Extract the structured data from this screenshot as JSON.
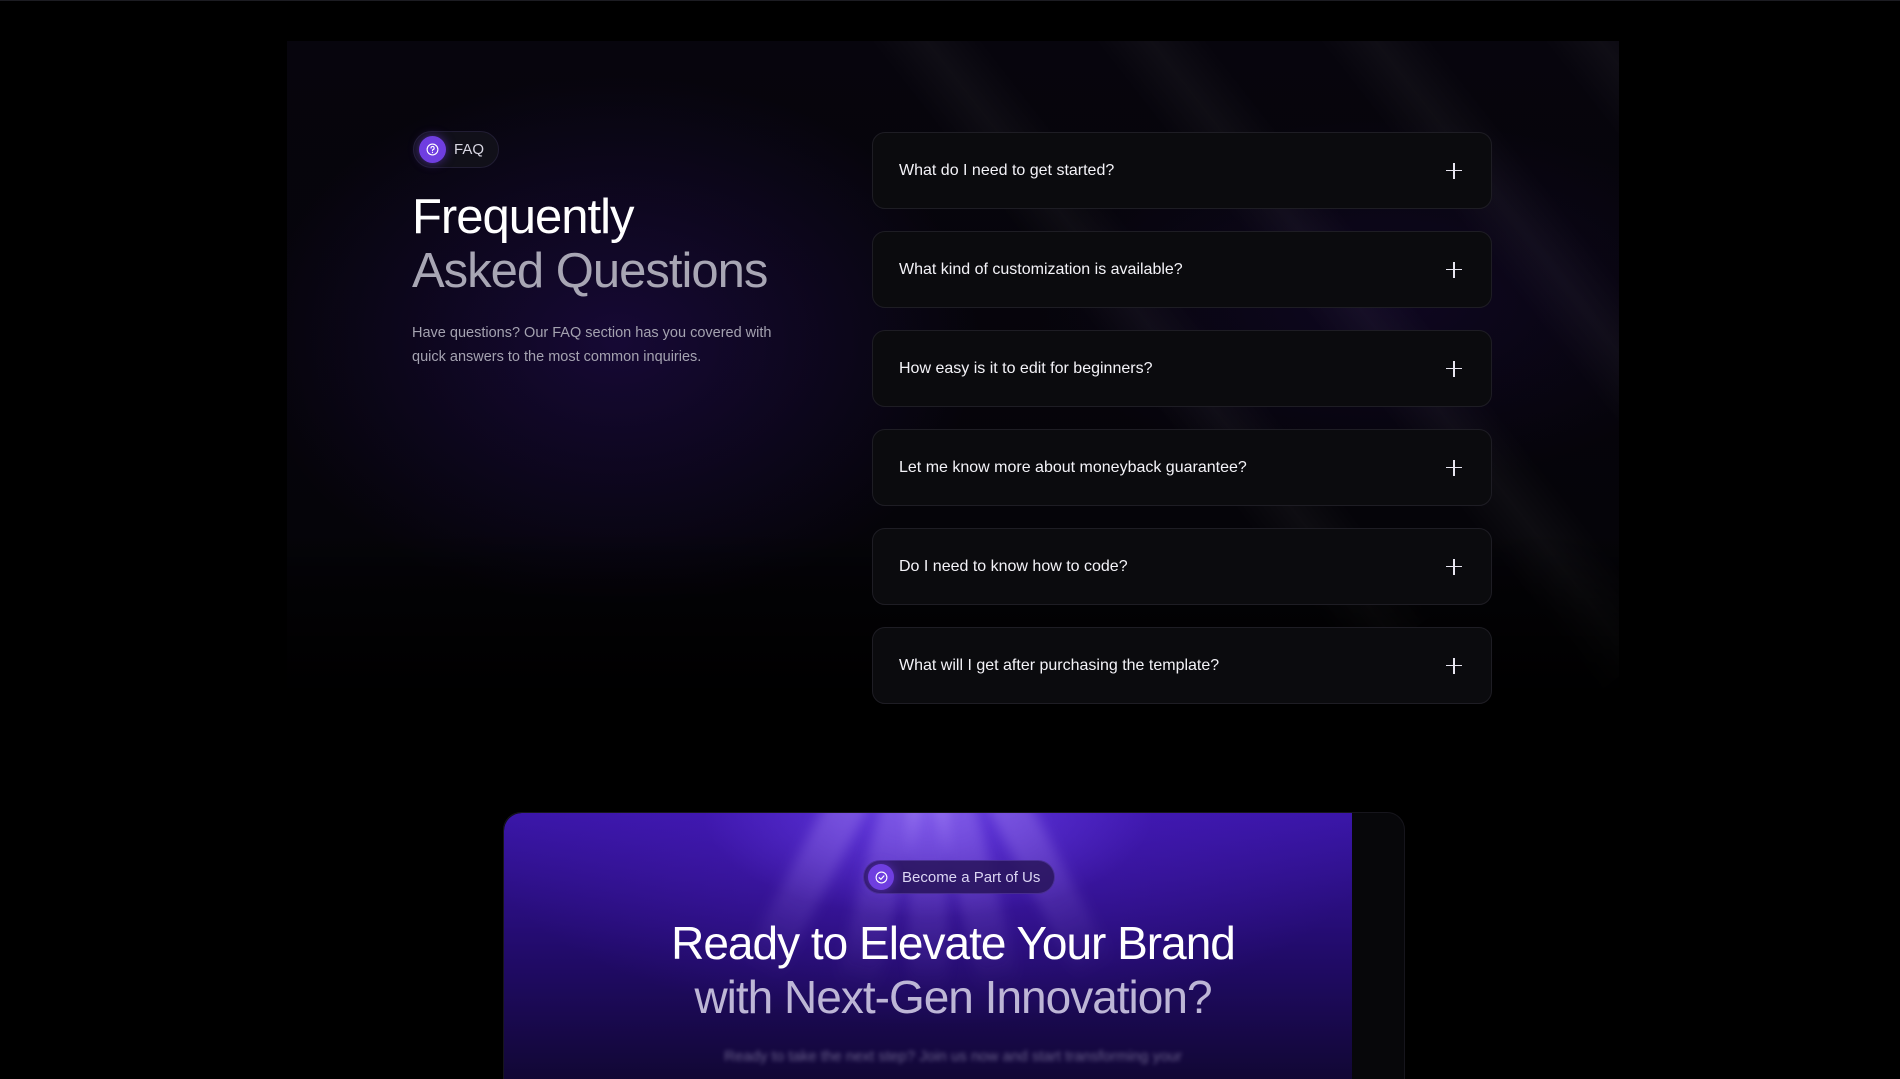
{
  "faq": {
    "badge_label": "FAQ",
    "title_line1": "Frequently",
    "title_line2": "Asked Questions",
    "description": "Have questions? Our FAQ section has you covered with quick answers to the most common inquiries.",
    "items": [
      {
        "question": "What do I need to get started?"
      },
      {
        "question": "What kind of customization is available?"
      },
      {
        "question": "How easy is it to edit for beginners?"
      },
      {
        "question": "Let me know more about moneyback guarantee?"
      },
      {
        "question": "Do I need to know how to code?"
      },
      {
        "question": "What will I get after purchasing the template?"
      }
    ]
  },
  "cta": {
    "badge_label": "Become a Part of Us",
    "title_line1": "Ready to Elevate Your Brand",
    "title_line2": "with Next-Gen Innovation?",
    "subtitle": "Ready to take the next step? Join us now and start transforming your"
  },
  "colors": {
    "accent": "#6f3ee0",
    "background": "#000000",
    "card": "#0b0b0e",
    "cta_purple": "#3a16a8"
  },
  "icons": {
    "faq_badge": "question-circle-icon",
    "cta_badge": "check-circle-icon",
    "accordion_toggle": "plus-icon"
  }
}
